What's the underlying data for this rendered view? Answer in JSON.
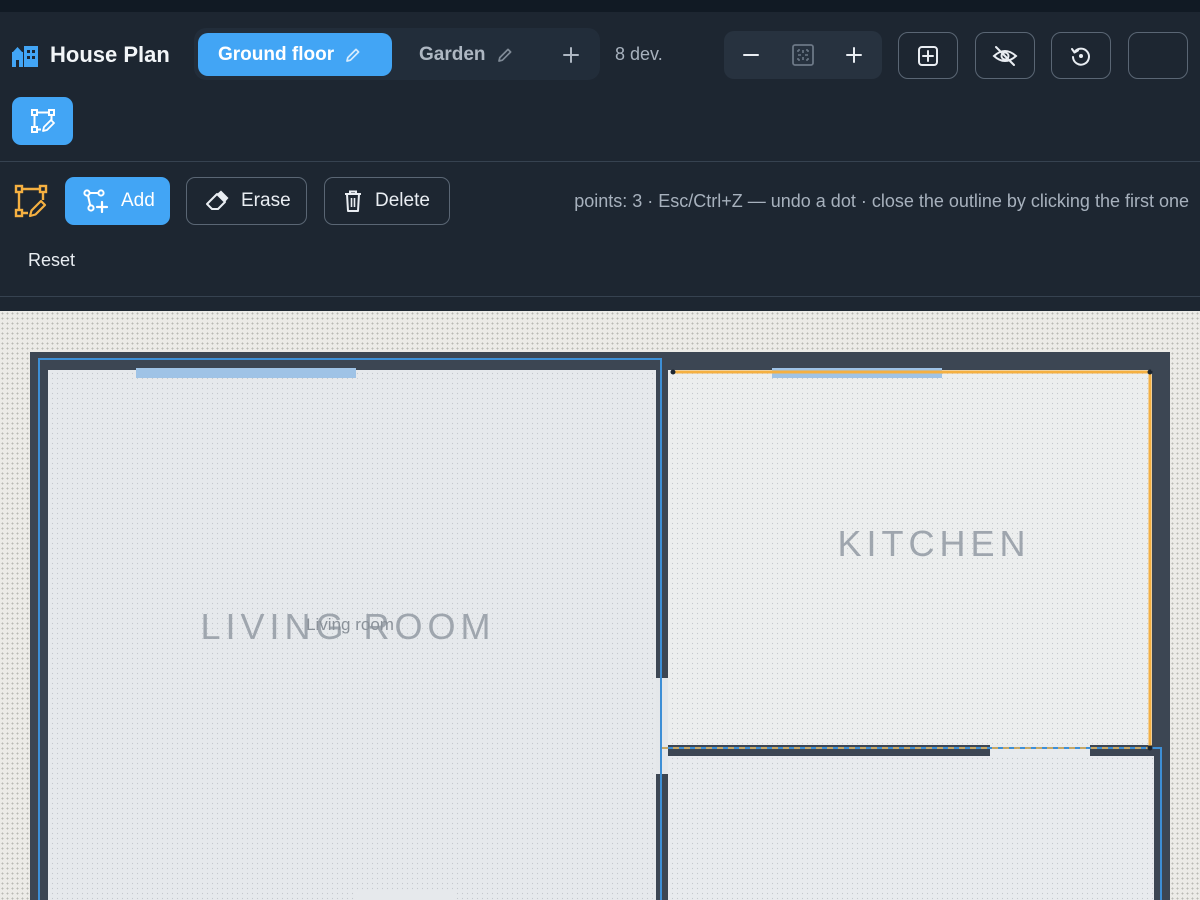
{
  "app": {
    "title": "House Plan",
    "icon": "house-icon"
  },
  "tabs": [
    {
      "label": "Ground floor",
      "active": true,
      "icon": "pencil-icon"
    },
    {
      "label": "Garden",
      "active": false,
      "icon": "pencil-icon"
    }
  ],
  "tab_add_icon": "plus-icon",
  "device_count": "8 dev.",
  "zoom": {
    "out_icon": "minus-icon",
    "fit_icon": "fit-icon",
    "in_icon": "plus-icon"
  },
  "actions": [
    {
      "icon": "plus-square-icon"
    },
    {
      "icon": "eye-off-icon"
    },
    {
      "icon": "history-icon"
    },
    {
      "icon": ""
    }
  ],
  "edit_mode_icon": "draw-polygon-icon",
  "draw_toolbar": {
    "icon": "draw-polygon-icon",
    "add_label": "Add",
    "erase_label": "Erase",
    "delete_label": "Delete",
    "hint": "points: 3 · Esc/Ctrl+Z — undo a dot · close the outline by clicking the first one",
    "reset_label": "Reset"
  },
  "plan": {
    "rooms": [
      {
        "label": "LIVING ROOM",
        "sublabel": "Living room"
      },
      {
        "label": "KITCHEN"
      },
      {
        "label": ""
      }
    ]
  },
  "colors": {
    "accent": "#42a5f5",
    "background": "#1d2631",
    "wall": "#3c4653",
    "selection": "#f5b041",
    "room_outline": "#3d8fd6"
  }
}
